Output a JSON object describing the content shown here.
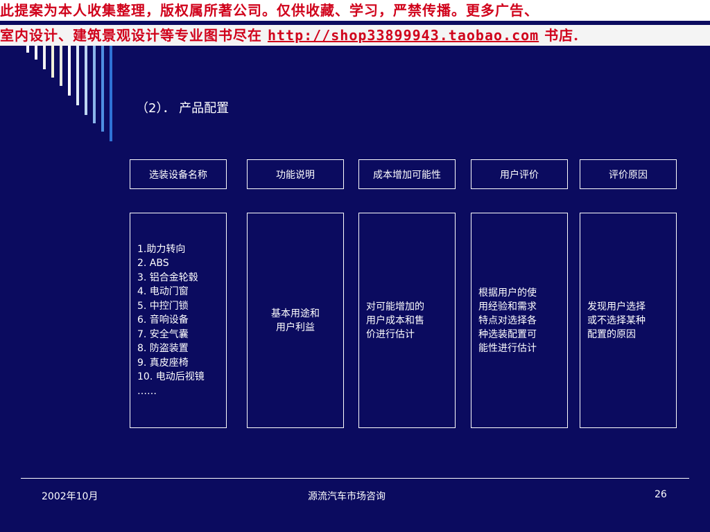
{
  "banner": {
    "line1": "此提案为本人收集整理，版权属所著公司。仅供收藏、学习，严禁传播。更多广告、",
    "line2_prefix": "室内设计、建筑景观设计等专业图书尽在 ",
    "line2_url": "http://shop33899943.taobao.com",
    "line2_suffix": " 书店."
  },
  "slide": {
    "section_title": "（2）． 产品配置",
    "headers": [
      "选装设备名称",
      "功能说明",
      "成本增加可能性",
      "用户评价",
      "评价原因"
    ],
    "equipment_list": [
      "1.助力转向",
      "2. ABS",
      "3. 铝合金轮毂",
      "4. 电动门窗",
      "5. 中控门锁",
      "6. 音响设备",
      "7. 安全气囊",
      "8. 防盗装置",
      "9. 真皮座椅",
      "10. 电动后视镜",
      "……"
    ],
    "function_desc": [
      "基本用途和",
      "用户利益"
    ],
    "cost_desc": [
      "对可能增加的",
      "用户成本和售",
      "价进行估计"
    ],
    "user_eval": [
      "根据用户的使",
      "用经验和需求",
      "特点对选择各",
      "种选装配置可",
      "能性进行估计"
    ],
    "eval_reason": [
      "发现用户选择",
      "或不选择某种",
      "配置的原因"
    ]
  },
  "footer": {
    "date": "2002年10月",
    "org": "源流汽车市场咨询",
    "page": "26"
  },
  "colors": {
    "background": "#0b0b5f",
    "banner_text": "#d0021b",
    "box_border": "#ffffff",
    "text": "#ffffff"
  }
}
